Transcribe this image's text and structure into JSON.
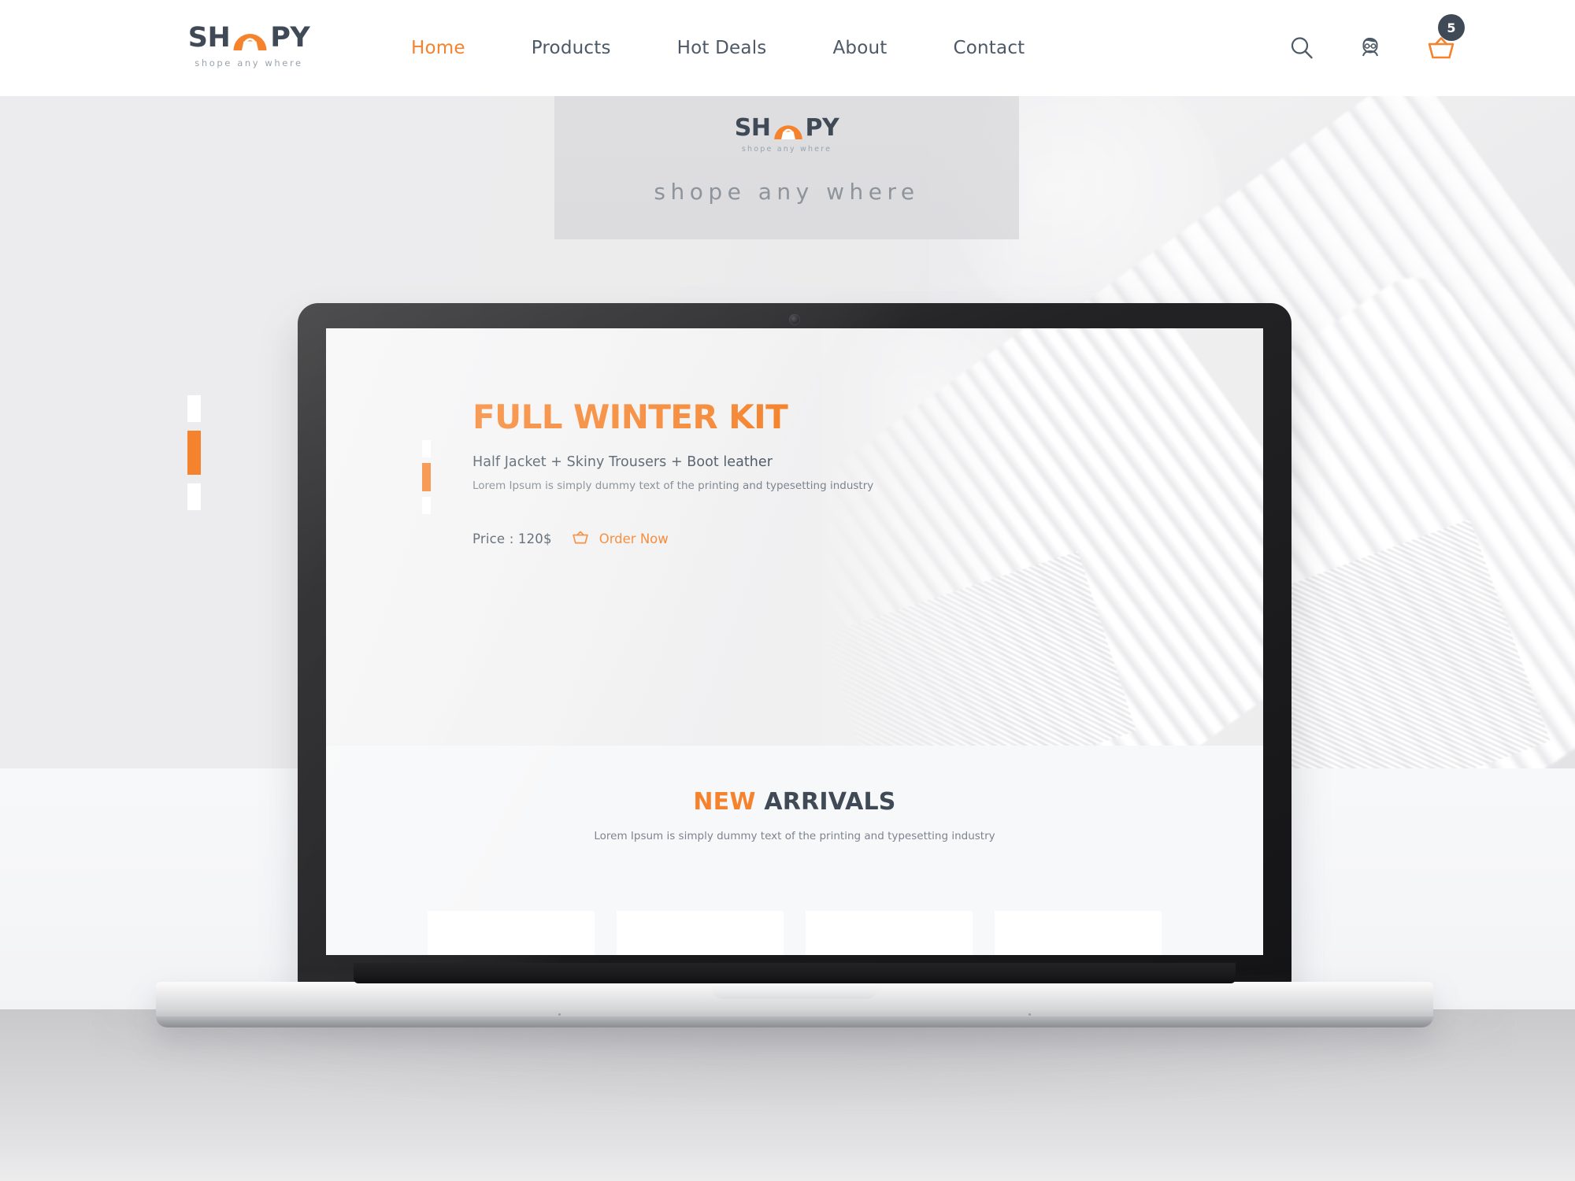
{
  "brand": {
    "name_left": "SH",
    "name_right": "PY",
    "tagline": "shope any where",
    "basket_icon": "basket-logo-icon",
    "accent_color": "#f5832d",
    "dark_color": "#3f4a56"
  },
  "header": {
    "nav": [
      {
        "label": "Home",
        "active": true
      },
      {
        "label": "Products",
        "active": false
      },
      {
        "label": "Hot Deals",
        "active": false
      },
      {
        "label": "About",
        "active": false
      },
      {
        "label": "Contact",
        "active": false
      }
    ],
    "icons": {
      "search": "search-icon",
      "account": "user-account-icon",
      "cart": "shopping-basket-icon",
      "cart_count": "5"
    }
  },
  "hero_banner": {
    "logo_left": "SH",
    "logo_right": "PY",
    "logo_sub": "shope any where",
    "tagline": "shope any where"
  },
  "outer_slider": {
    "bars": [
      {
        "active": false
      },
      {
        "active": true
      },
      {
        "active": false
      }
    ]
  },
  "laptop_screen": {
    "slider": {
      "bars": [
        {
          "active": false
        },
        {
          "active": true
        },
        {
          "active": false
        }
      ]
    },
    "hero": {
      "title": "FULL WINTER KIT",
      "subtitle": "Half Jacket + Skiny Trousers + Boot leather",
      "description": "Lorem Ipsum is simply dummy text of the printing and typesetting industry",
      "price_label": "Price : 120$",
      "order_button": "Order Now",
      "order_icon": "basket-icon"
    },
    "arrivals": {
      "title_highlight": "NEW",
      "title_rest": "ARRIVALS",
      "subtitle": "Lorem Ipsum is simply dummy text of the printing and typesetting industry",
      "cards": [
        {
          "label": ""
        },
        {
          "label": ""
        },
        {
          "label": ""
        },
        {
          "label": ""
        }
      ]
    }
  }
}
